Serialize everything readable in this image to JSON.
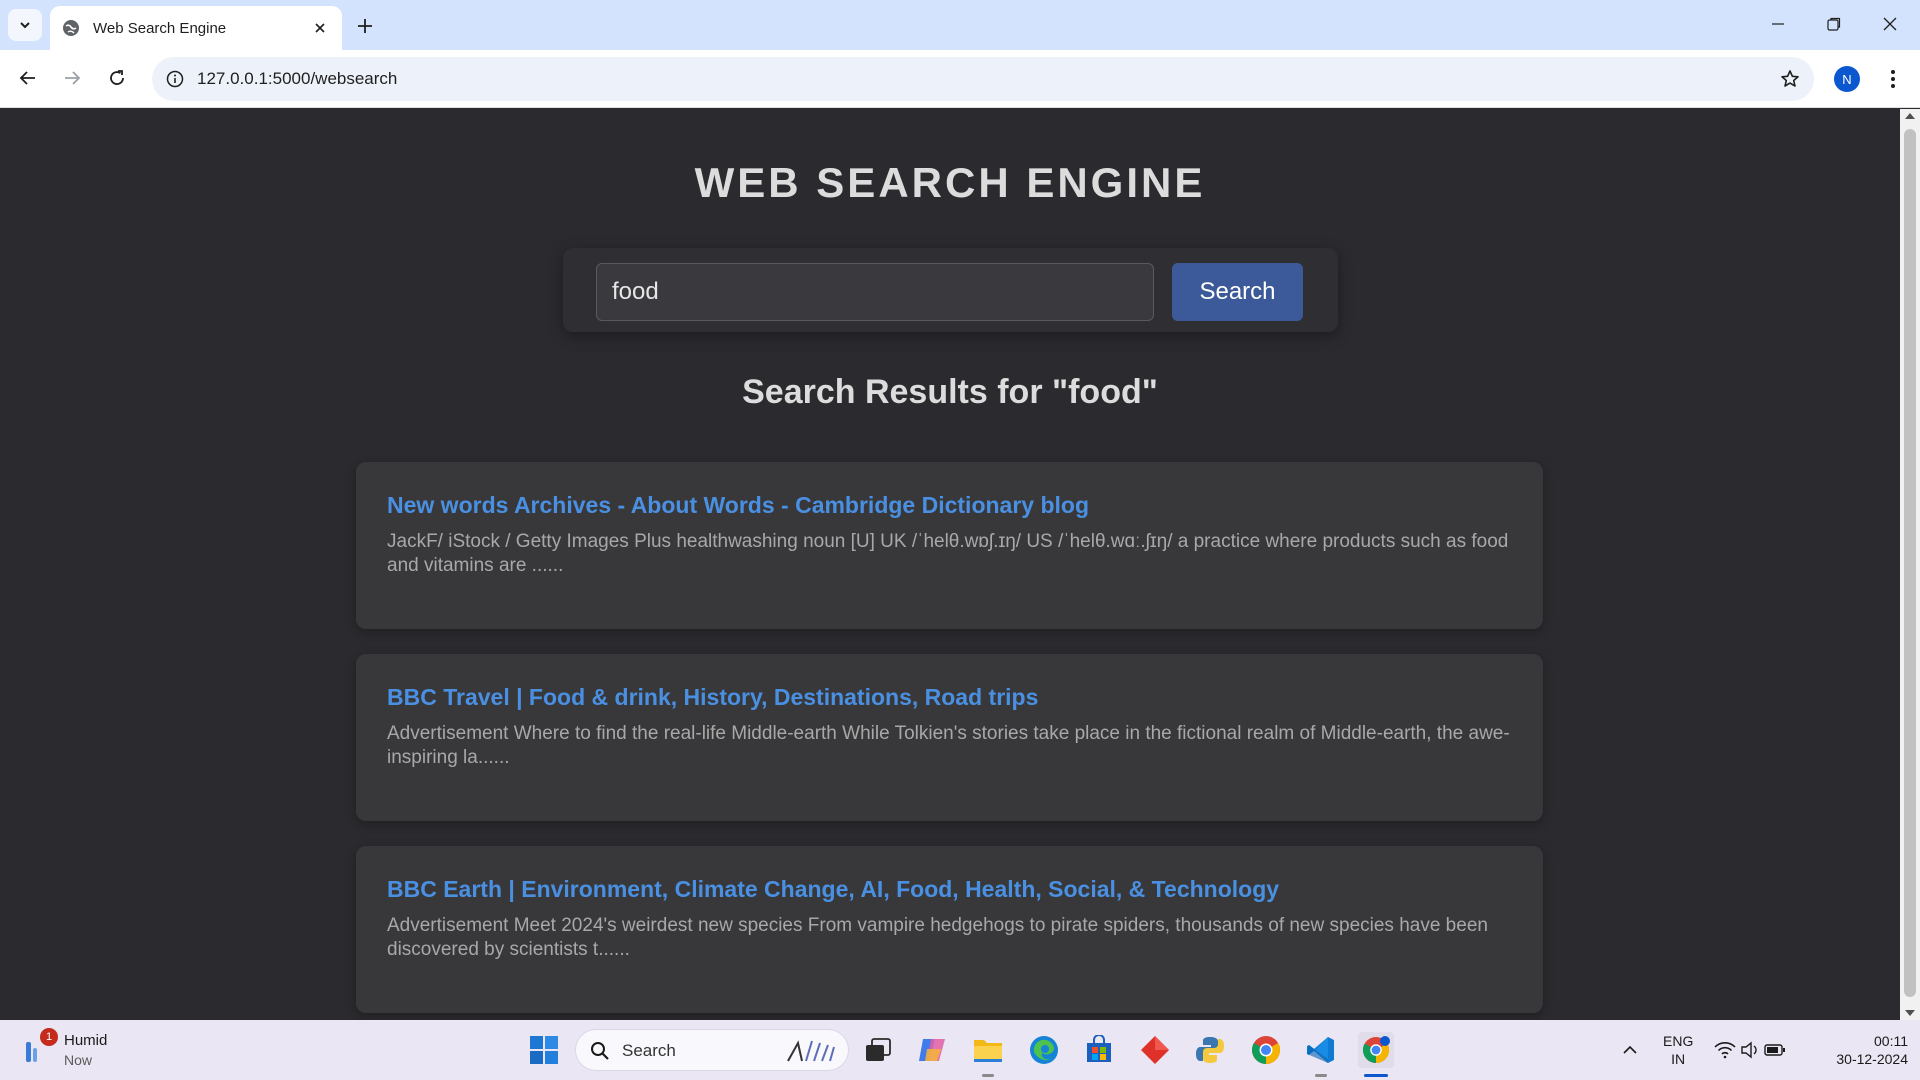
{
  "browser": {
    "tab_title": "Web Search Engine",
    "url": "127.0.0.1:5000/websearch",
    "profile_initial": "N"
  },
  "page": {
    "site_title": "WEB SEARCH ENGINE",
    "search_value": "food",
    "search_button": "Search",
    "results_heading": "Search Results for \"food\"",
    "results": [
      {
        "title": "New words Archives - About Words - Cambridge Dictionary blog",
        "snippet": "JackF/ iStock / Getty Images Plus healthwashing noun [U] UK /ˈhelθ.wɒʃ.ɪŋ/ US /ˈhelθ.wɑː.ʃɪŋ/ a practice where products such as food and vitamins are ......"
      },
      {
        "title": "BBC Travel | Food & drink, History, Destinations, Road trips",
        "snippet": "Advertisement Where to find the real-life Middle-earth While Tolkien's stories take place in the fictional realm of Middle-earth, the awe-inspiring la......"
      },
      {
        "title": "BBC Earth | Environment, Climate Change, AI, Food, Health, Social, & Technology",
        "snippet": "Advertisement Meet 2024's weirdest new species From vampire hedgehogs to pirate spiders, thousands of new species have been discovered by scientists t......"
      }
    ]
  },
  "taskbar": {
    "weather_title": "Humid",
    "weather_sub": "Now",
    "notification_count": "1",
    "search_label": "Search",
    "lang_1": "ENG",
    "lang_2": "IN",
    "time": "00:11",
    "date": "30-12-2024"
  },
  "colors": {
    "page_bg": "#2b2b2f",
    "card_bg": "#38383b",
    "link": "#4a90e2",
    "button": "#3c5a99"
  }
}
